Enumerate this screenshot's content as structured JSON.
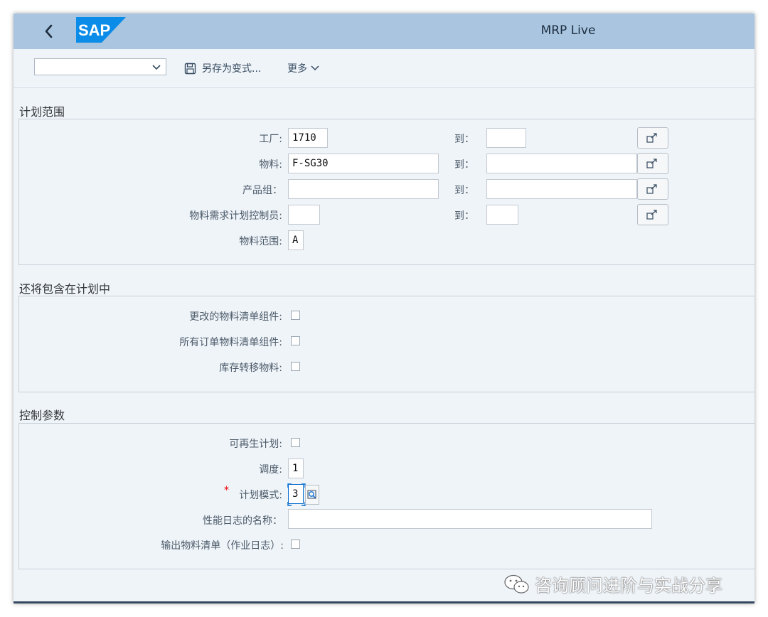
{
  "shell": {
    "app_title": "MRP Live",
    "logo_text": "SAP",
    "back_icon": "chevron-left-icon"
  },
  "toolbar": {
    "variant_value": "",
    "save_variant_label": "另存为变式...",
    "more_label": "更多",
    "save_icon": "floppy-disk-icon",
    "more_icon": "chevron-down-icon"
  },
  "sections": {
    "planning_scope": {
      "title": "计划范围",
      "to_label": "到：",
      "fields": [
        {
          "label": "工厂:",
          "value": "1710",
          "to_value": ""
        },
        {
          "label": "物料:",
          "value": "F-SG30",
          "to_value": ""
        },
        {
          "label": "产品组：",
          "value": "",
          "to_value": ""
        },
        {
          "label": "物料需求计划控制员:",
          "value": "",
          "to_value": ""
        }
      ],
      "material_scope": {
        "label": "物料范围:",
        "value": "A"
      },
      "multi_select_icon": "multiple-selection-icon"
    },
    "also_include": {
      "title": "还将包含在计划中",
      "checkboxes": [
        {
          "label": "更改的物料清单组件:",
          "checked": false
        },
        {
          "label": "所有订单物料清单组件:",
          "checked": false
        },
        {
          "label": "库存转移物料:",
          "checked": false
        }
      ]
    },
    "control_params": {
      "title": "控制参数",
      "regenerative": {
        "label": "可再生计划:",
        "checked": false
      },
      "scheduling": {
        "label": "调度:",
        "value": "1"
      },
      "planning_mode": {
        "label": "计划模式:",
        "value": "3",
        "required_mark": "*"
      },
      "perf_log_name": {
        "label": "性能日志的名称：",
        "value": ""
      },
      "output_bom": {
        "label": "输出物料清单（作业日志）:",
        "checked": false
      }
    }
  },
  "watermark": {
    "text": "咨询顾问进阶与实战分享",
    "icon": "wechat-icon"
  },
  "colors": {
    "shell_bar": "#a9c5e0",
    "background": "#eff4f9",
    "logo_blue": "#0a8ce8",
    "required": "#e00000"
  }
}
